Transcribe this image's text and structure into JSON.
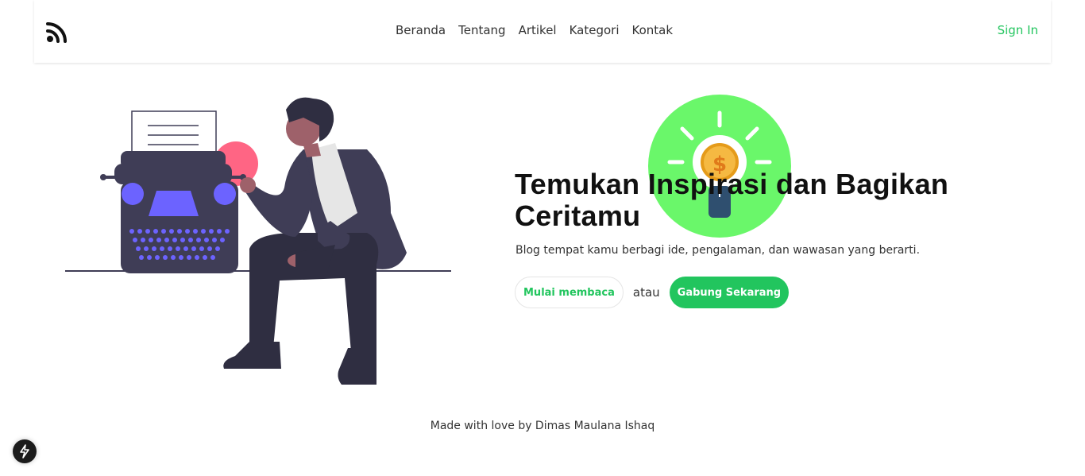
{
  "navbar": {
    "logo_icon": "rss-icon",
    "items": [
      {
        "label": "Beranda"
      },
      {
        "label": "Tentang"
      },
      {
        "label": "Artikel"
      },
      {
        "label": "Kategori"
      },
      {
        "label": "Kontak"
      }
    ],
    "signin_label": "Sign In"
  },
  "hero": {
    "title": "Temukan Inspirasi dan Bagikan Ceritamu",
    "subtitle": "Blog tempat kamu berbagi ide, pengalaman, dan wawasan yang berarti.",
    "primary_label": "Mulai membaca",
    "or_label": "atau",
    "secondary_label": "Gabung Sekarang",
    "illustration_icon": "typewriter-man-illustration",
    "bulb_icon": "lightbulb-dollar-icon"
  },
  "footer": {
    "text": "Made with love by Dimas Maulana Ishaq"
  },
  "fab": {
    "icon": "lightning-icon"
  },
  "colors": {
    "accent": "#22c55e",
    "bulb_bg": "#6af76a",
    "illustration_purple": "#6c63ff",
    "illustration_dark": "#3f3d56",
    "illustration_pink": "#ff6584"
  }
}
